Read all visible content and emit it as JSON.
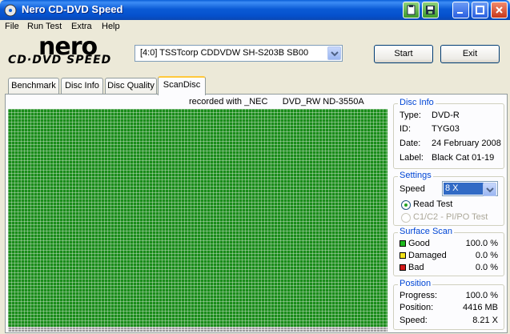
{
  "window": {
    "title": "Nero CD-DVD Speed"
  },
  "menu": {
    "items": [
      "File",
      "Run Test",
      "Extra",
      "Help"
    ]
  },
  "logo": {
    "brand": "nero",
    "product": "CD·DVD SPEED"
  },
  "drive": {
    "selected": "[4:0]   TSSTcorp CDDVDW SH-S203B SB00"
  },
  "buttons": {
    "start": "Start",
    "exit": "Exit"
  },
  "tabs": [
    {
      "label": "Benchmark"
    },
    {
      "label": "Disc Info"
    },
    {
      "label": "Disc Quality"
    },
    {
      "label": "ScanDisc",
      "active": true
    }
  ],
  "scan": {
    "recorded_with": "recorded with _NEC      DVD_RW ND-3550A"
  },
  "disc_info": {
    "title": "Disc Info",
    "type_label": "Type:",
    "type": "DVD-R",
    "id_label": "ID:",
    "id": "TYG03",
    "date_label": "Date:",
    "date": "24 February 2008",
    "label_label": "Label:",
    "label": "Black Cat 01-19"
  },
  "settings": {
    "title": "Settings",
    "speed_label": "Speed",
    "speed": "8 X",
    "read_test": "Read Test",
    "c1c2_test": "C1/C2 - PI/PO Test"
  },
  "surface_scan": {
    "title": "Surface Scan",
    "good_label": "Good",
    "good": "100.0 %",
    "damaged_label": "Damaged",
    "damaged": "0.0 %",
    "bad_label": "Bad",
    "bad": "0.0 %",
    "colors": {
      "good": "#1eb91e",
      "damaged": "#f2e21a",
      "bad": "#d41a1a"
    }
  },
  "position": {
    "title": "Position",
    "progress_label": "Progress:",
    "progress": "100.0 %",
    "position_label": "Position:",
    "position": "4416 MB",
    "speed_label": "Speed:",
    "speed": "8.21 X"
  },
  "accent": {
    "group_title": "#0046d5",
    "scan_good": "#1a8c1a"
  }
}
